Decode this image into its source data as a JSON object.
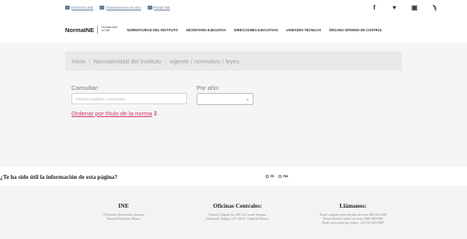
{
  "topbar": {
    "links": [
      {
        "icon": "directory-icon",
        "label": "Directorio INE"
      },
      {
        "icon": "transparency-icon",
        "label": "Transmisiones en vivo"
      },
      {
        "icon": "portal-icon",
        "label": "Portal INE"
      }
    ],
    "social": [
      {
        "icon": "facebook-icon",
        "glyph": "f"
      },
      {
        "icon": "twitter-icon",
        "glyph": "♥"
      },
      {
        "icon": "youtube-icon",
        "glyph": "▣"
      },
      {
        "icon": "rss-icon",
        "glyph": "ϡ"
      }
    ]
  },
  "navbar": {
    "brand": "NormaINE",
    "brand_sub": "Normatividad del INE",
    "items": [
      "NORMATIVIDAD DEL INSTITUTO",
      "SECRETARÍA EJECUTIVA",
      "DIRECCIONES EJECUTIVAS",
      "UNIDADES TÉCNICAS",
      "ÓRGANO INTERNO DE CONTROL"
    ]
  },
  "breadcrumb": {
    "items": [
      "Inicio",
      "Normatividad del Instituto",
      "vigente / normativo / leyes"
    ]
  },
  "search": {
    "consult_label": "Consultar:",
    "placeholder": "Introduce palabra o enunciado",
    "year_label": "Por año:",
    "year_value": "",
    "order_link": "Ordenar por título de la norma",
    "order_icon": "⇕"
  },
  "feedback": {
    "question": "¿Te ha sido útil la información de esta página?",
    "options": [
      "Sí",
      "No"
    ]
  },
  "footer": {
    "columns": [
      {
        "title": "INE",
        "lines": [
          "® Derechos Reservados, Instituto",
          "Nacional Electoral, México"
        ]
      },
      {
        "title": "Oficinas Centrales:",
        "lines": [
          "Viaducto Tlalpan No. 100 Col. Arenal Tepepan,",
          "Delegación Tlalpan, C.P. 14610, Ciudad de México"
        ]
      },
      {
        "title": "Llámanos:",
        "lines": [
          "Desde cualquier parte del país sin costo: 800 433 2000",
          "Desde Estados Unidos sin costo: (866) 986 8306",
          "Desde otros países por cobrar: +52 (55) 5481 9897"
        ]
      }
    ]
  },
  "colors": {
    "accent_pink": "#d6336c",
    "footer_bg": "#f3f3f3",
    "main_bg": "#f5f5f5"
  }
}
